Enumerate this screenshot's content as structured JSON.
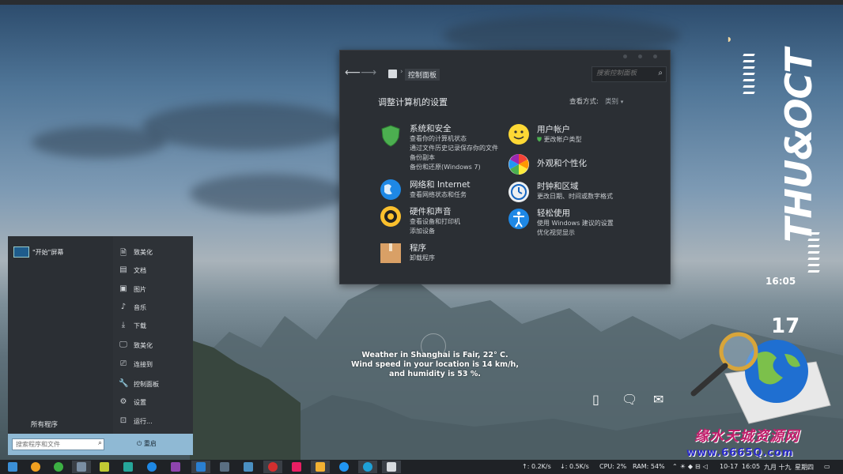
{
  "control_panel": {
    "back_icon": "arrow-left-icon",
    "forward_icon": "arrow-right-icon",
    "breadcrumb": "控制面板",
    "search_placeholder": "搜索控制面板",
    "heading": "调整计算机的设置",
    "view_by_label": "查看方式:",
    "view_by_value": "类别",
    "categories_left": [
      {
        "title": "系统和安全",
        "links": [
          "查看你的计算机状态",
          "通过文件历史记录保存你的文件",
          "备份副本",
          "备份和还原(Windows 7)"
        ],
        "icon": "shield-icon"
      },
      {
        "title": "网络和 Internet",
        "links": [
          "查看网络状态和任务"
        ],
        "icon": "globe-icon"
      },
      {
        "title": "硬件和声音",
        "links": [
          "查看设备和打印机",
          "添加设备"
        ],
        "icon": "speaker-icon"
      },
      {
        "title": "程序",
        "links": [
          "卸载程序"
        ],
        "icon": "box-icon"
      }
    ],
    "categories_right": [
      {
        "title": "用户帐户",
        "links": [
          "更改帐户类型"
        ],
        "icon": "smiley-icon"
      },
      {
        "title": "外观和个性化",
        "links": [],
        "icon": "color-wheel-icon"
      },
      {
        "title": "时钟和区域",
        "links": [
          "更改日期、时间或数字格式"
        ],
        "icon": "clock-icon"
      },
      {
        "title": "轻松使用",
        "links": [
          "使用 Windows 建议的设置",
          "优化视觉显示"
        ],
        "icon": "accessibility-icon"
      }
    ]
  },
  "start_menu": {
    "tile_label": "\"开始\"屏幕",
    "all_programs": "所有程序",
    "items": [
      {
        "label": "致美化",
        "icon": "user-doc-icon"
      },
      {
        "label": "文档",
        "icon": "document-icon"
      },
      {
        "label": "图片",
        "icon": "image-icon"
      },
      {
        "label": "音乐",
        "icon": "music-note-icon"
      },
      {
        "label": "下载",
        "icon": "download-icon"
      },
      {
        "label": "致美化",
        "icon": "monitor-icon"
      },
      {
        "label": "连接到",
        "icon": "connect-icon"
      },
      {
        "label": "控制面板",
        "icon": "wrench-icon"
      },
      {
        "label": "设置",
        "icon": "gear-icon"
      },
      {
        "label": "运行...",
        "icon": "run-icon"
      }
    ],
    "search_placeholder": "搜索程序和文件",
    "restart_label": "重启"
  },
  "weather": {
    "line1": "Weather in Shanghai is Fair, 22° C.",
    "line2": "Wind speed in your location is 14 km/h,",
    "line3": "and humidity is 53 %."
  },
  "desktop_widget": {
    "date_text": "THU&OCT",
    "time": "16:05",
    "day": "17"
  },
  "watermark": {
    "brand": "缘水天城资源网",
    "url": "www.6665Q.com"
  },
  "taskbar": {
    "net_up": "↑: 0.2K/s",
    "net_down": "↓: 0.5K/s",
    "cpu": "CPU: 2%",
    "ram": "RAM: 54%",
    "date": "10-17",
    "time": "16:05",
    "lunar": "九月 十九",
    "weekday": "星期四"
  }
}
